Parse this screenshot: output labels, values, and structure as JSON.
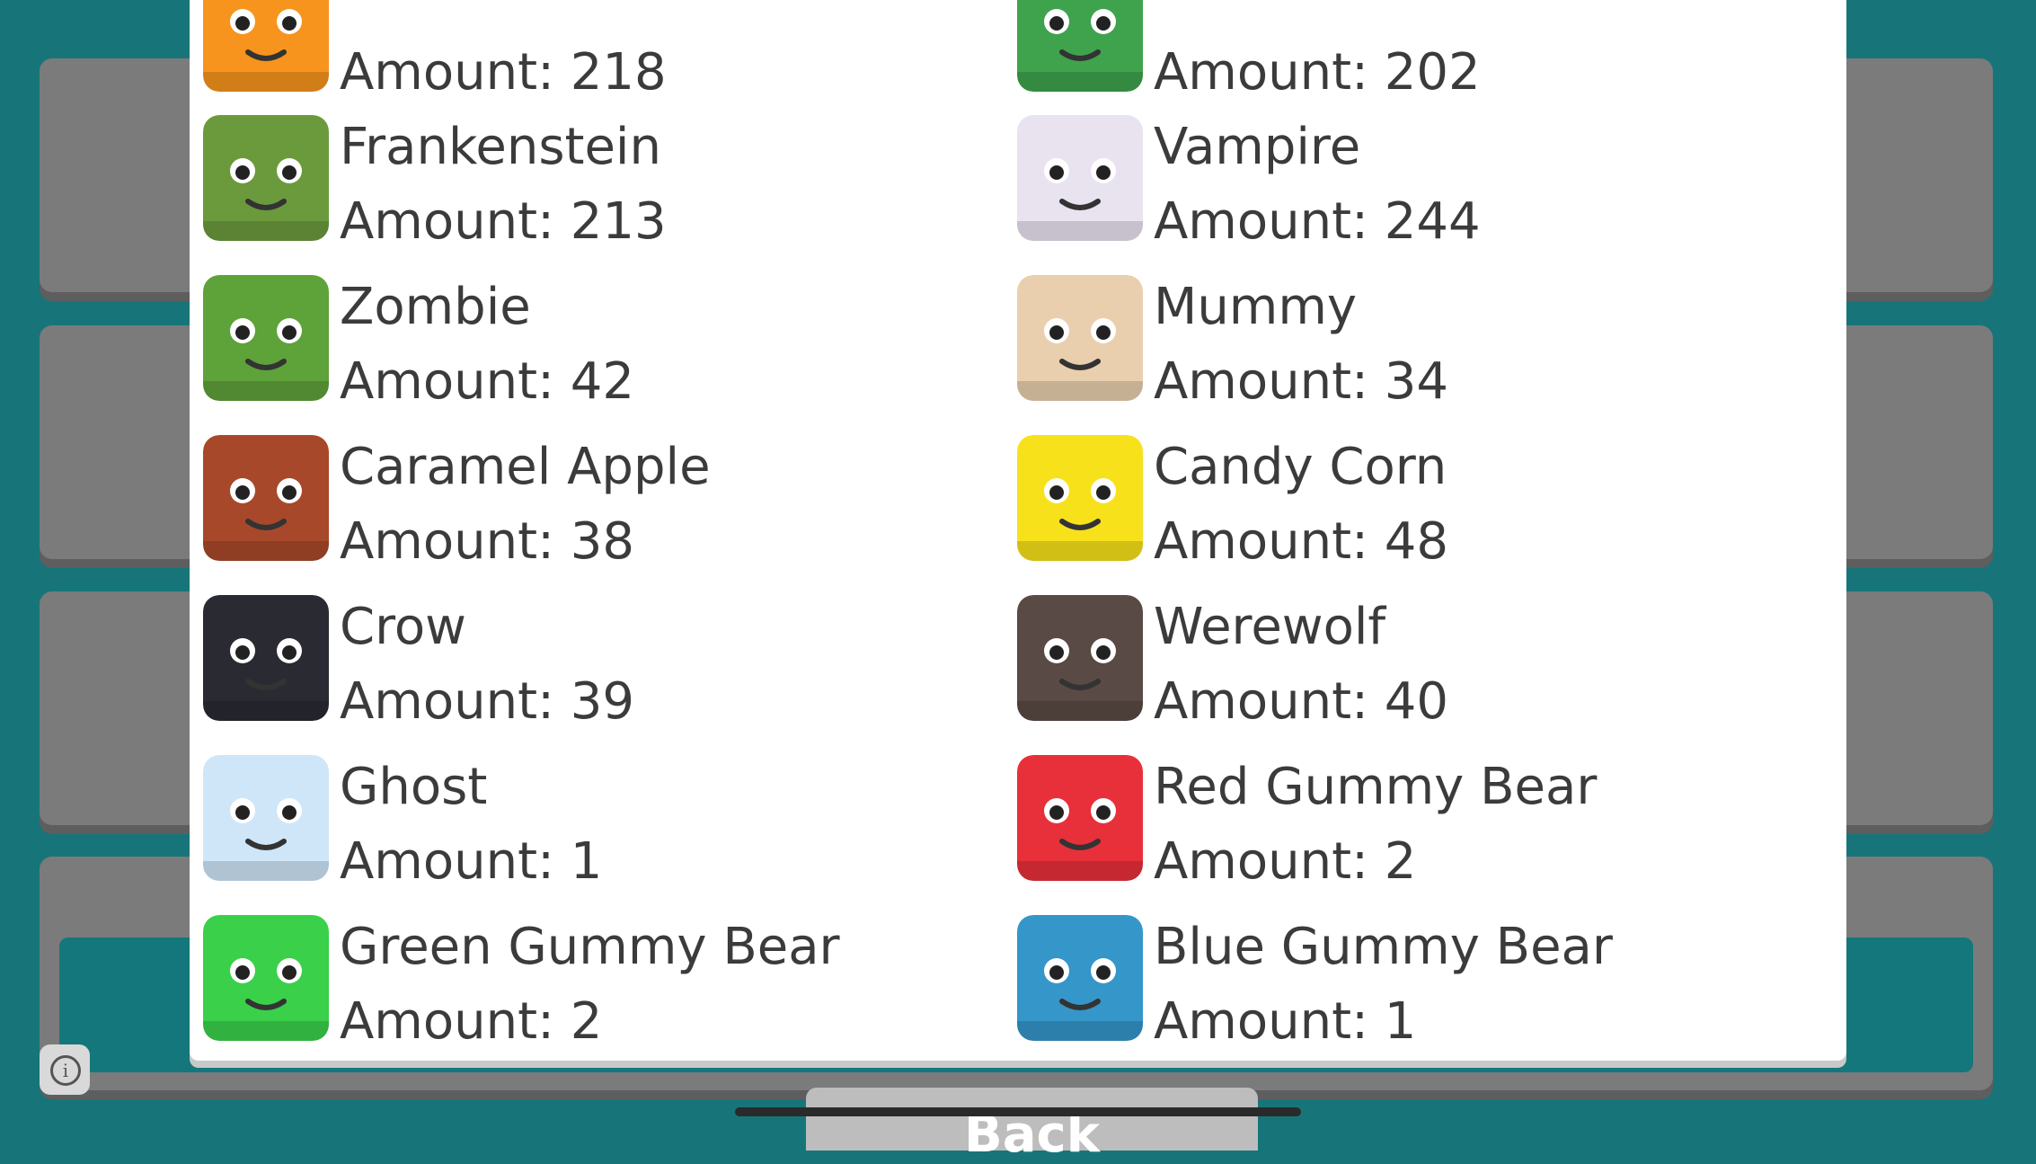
{
  "items": [
    {
      "name": "",
      "amount": "Amount: 218",
      "icon": "jack-o-lantern-icon",
      "color": "#f7941d"
    },
    {
      "name": "",
      "amount": "Amount: 202",
      "icon": "swamp-monster-icon",
      "color": "#3fa34d"
    },
    {
      "name": "Frankenstein",
      "amount": "Amount: 213",
      "icon": "frankenstein-icon",
      "color": "#6b9a3c"
    },
    {
      "name": "Vampire",
      "amount": "Amount: 244",
      "icon": "vampire-icon",
      "color": "#e9e3f0"
    },
    {
      "name": "Zombie",
      "amount": "Amount: 42",
      "icon": "zombie-icon",
      "color": "#5ea23a"
    },
    {
      "name": "Mummy",
      "amount": "Amount: 34",
      "icon": "mummy-icon",
      "color": "#e9cfae"
    },
    {
      "name": "Caramel Apple",
      "amount": "Amount: 38",
      "icon": "caramel-apple-icon",
      "color": "#a8482a"
    },
    {
      "name": "Candy Corn",
      "amount": "Amount: 48",
      "icon": "candy-corn-icon",
      "color": "#f7e11b"
    },
    {
      "name": "Crow",
      "amount": "Amount: 39",
      "icon": "crow-icon",
      "color": "#2a2a33"
    },
    {
      "name": "Werewolf",
      "amount": "Amount: 40",
      "icon": "werewolf-icon",
      "color": "#5a4a45"
    },
    {
      "name": "Ghost",
      "amount": "Amount: 1",
      "icon": "ghost-icon",
      "color": "#cfe6f8"
    },
    {
      "name": "Red Gummy Bear",
      "amount": "Amount: 2",
      "icon": "red-gummy-bear-icon",
      "color": "#e8303a"
    },
    {
      "name": "Green Gummy Bear",
      "amount": "Amount: 2",
      "icon": "green-gummy-bear-icon",
      "color": "#3ad04a"
    },
    {
      "name": "Blue Gummy Bear",
      "amount": "Amount: 1",
      "icon": "blue-gummy-bear-icon",
      "color": "#3596c9"
    }
  ],
  "back_label": "Back",
  "info_label": "i"
}
